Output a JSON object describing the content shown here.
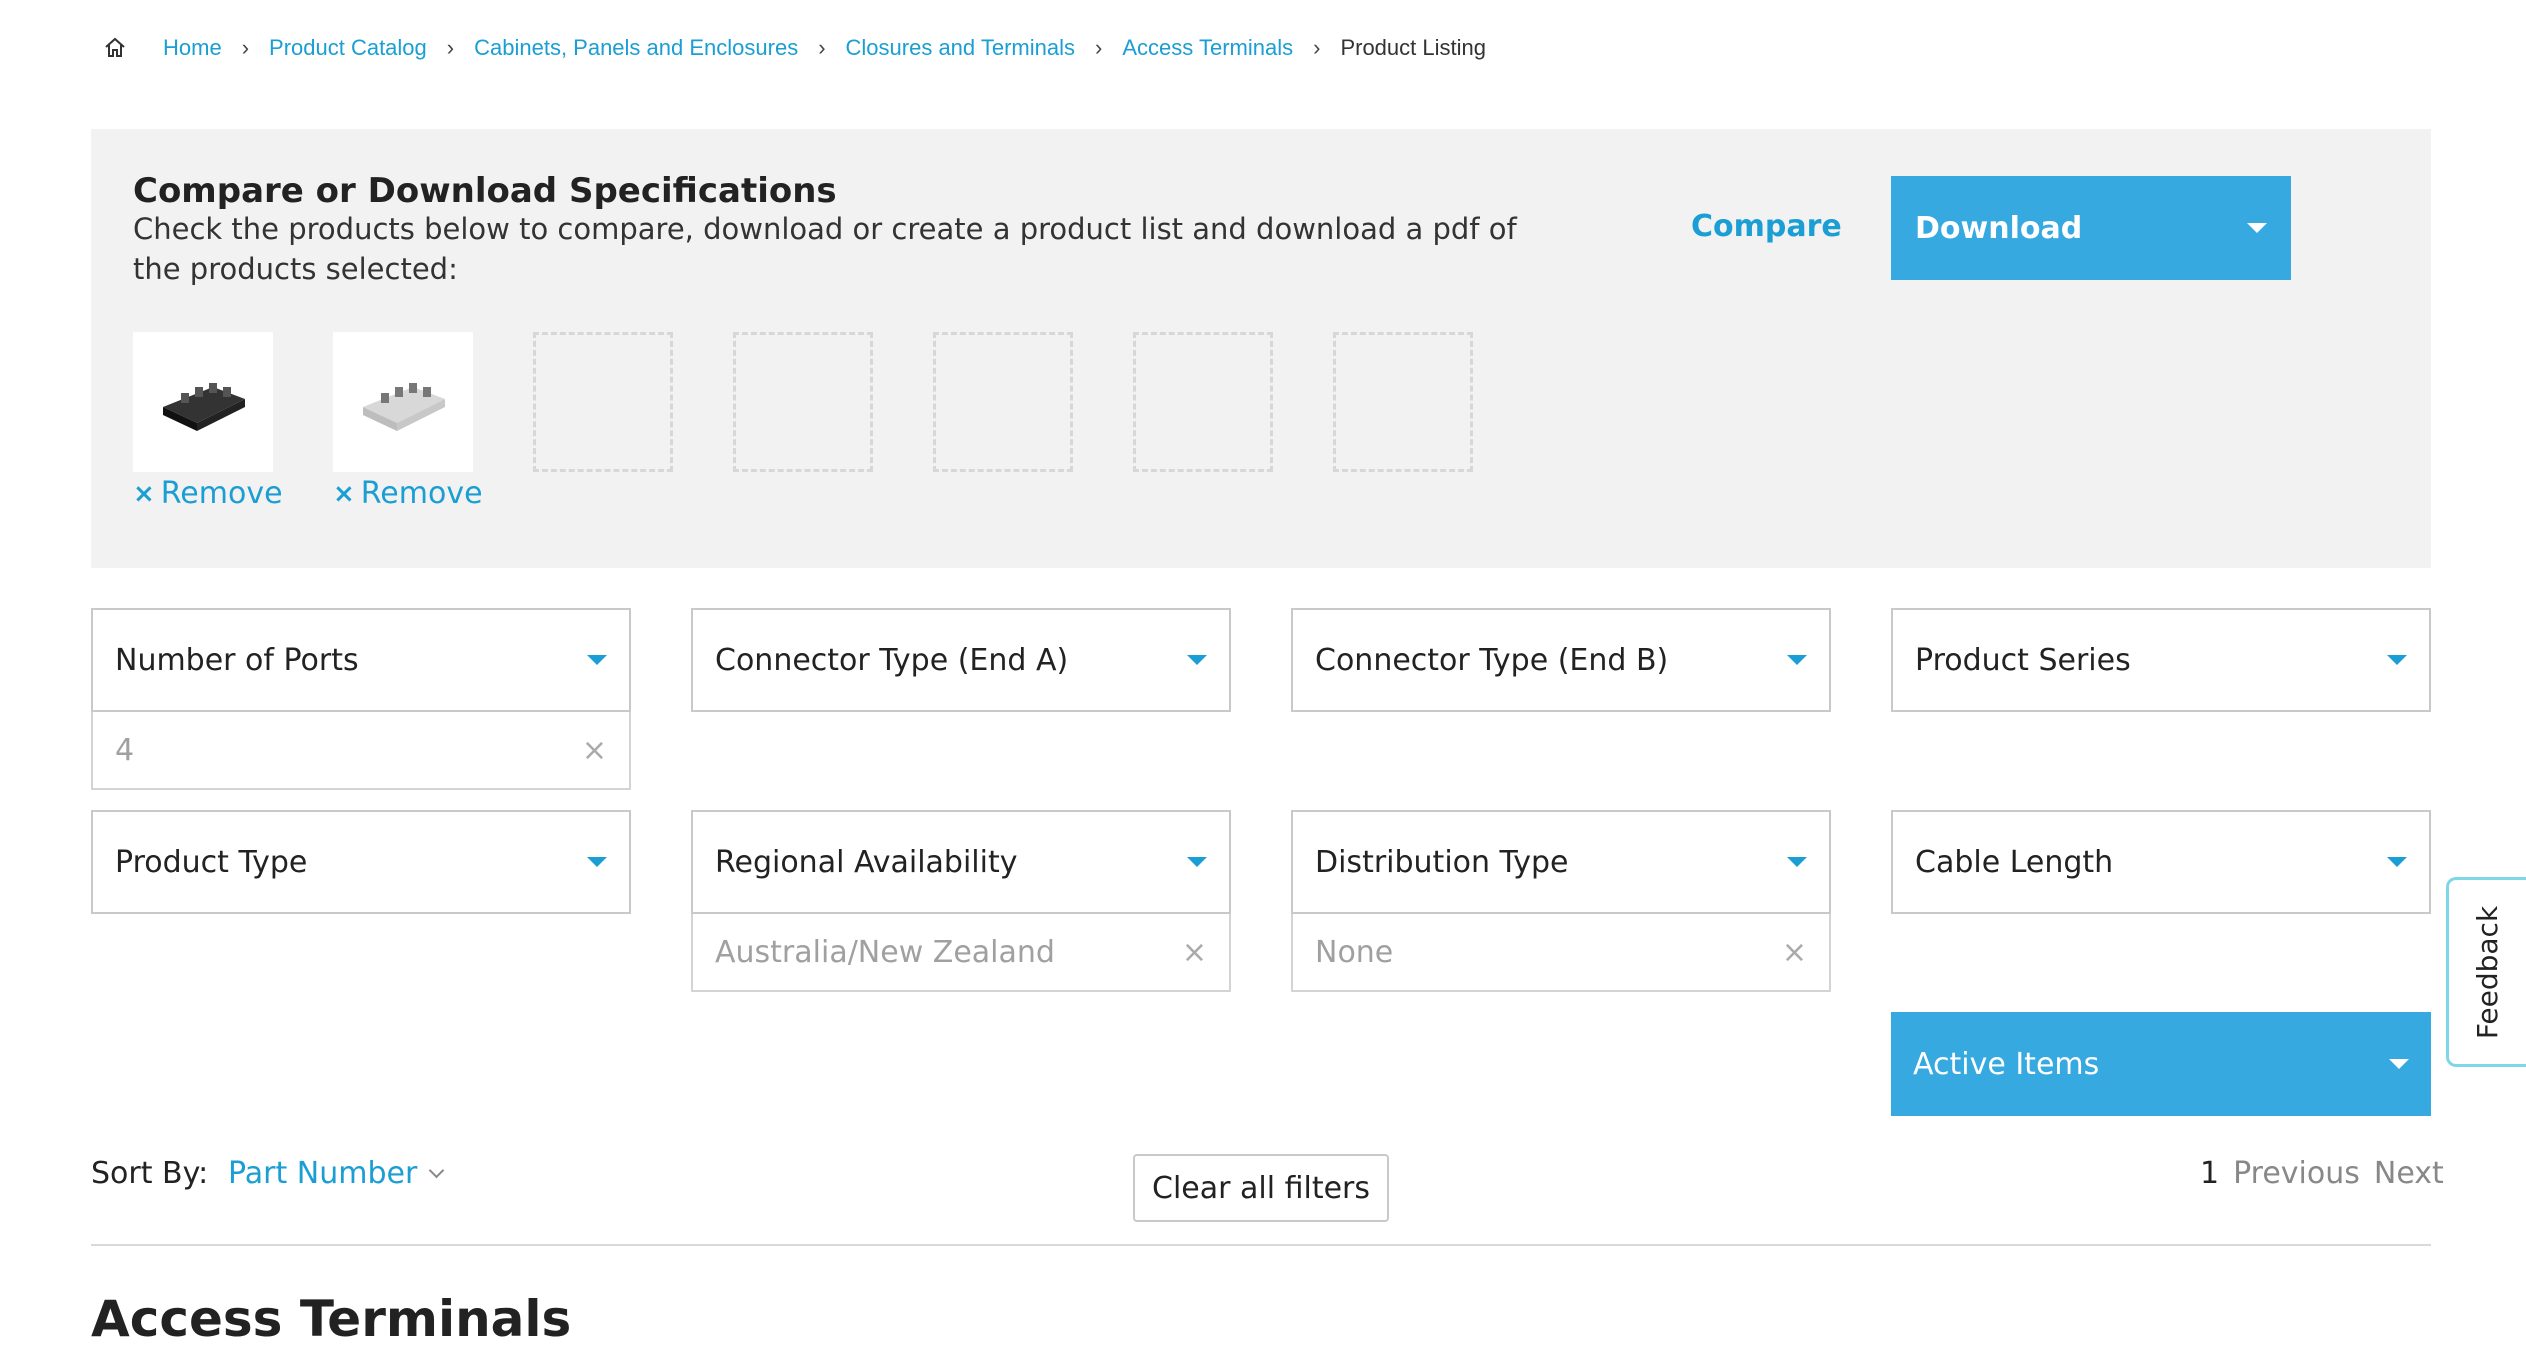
{
  "breadcrumb": {
    "items": [
      "Home",
      "Product Catalog",
      "Cabinets, Panels and Enclosures",
      "Closures and Terminals",
      "Access Terminals"
    ],
    "current": "Product Listing"
  },
  "compare": {
    "title": "Compare or Download Specifications",
    "description": "Check the products below to compare, download or create a product list and download a pdf of the products selected:",
    "compare_label": "Compare",
    "download_label": "Download",
    "remove_label": "Remove",
    "selected_count": 2,
    "slot_count": 7
  },
  "filters": [
    {
      "label": "Number of Ports",
      "value": "4"
    },
    {
      "label": "Connector Type (End A)",
      "value": null
    },
    {
      "label": "Connector Type (End B)",
      "value": null
    },
    {
      "label": "Product Series",
      "value": null
    },
    {
      "label": "Product Type",
      "value": null
    },
    {
      "label": "Regional Availability",
      "value": "Australia/New Zealand"
    },
    {
      "label": "Distribution Type",
      "value": "None"
    },
    {
      "label": "Cable Length",
      "value": null
    }
  ],
  "active_items_label": "Active Items",
  "feedback_label": "Feedback",
  "sort": {
    "label": "Sort By:",
    "value": "Part Number"
  },
  "clear_filters_label": "Clear all filters",
  "pagination": {
    "current_page": "1",
    "previous_label": "Previous",
    "next_label": "Next"
  },
  "section_title": "Access Terminals",
  "colors": {
    "accent": "#36a9e1",
    "link": "#1a9ed4",
    "panel_bg": "#f2f2f2"
  }
}
